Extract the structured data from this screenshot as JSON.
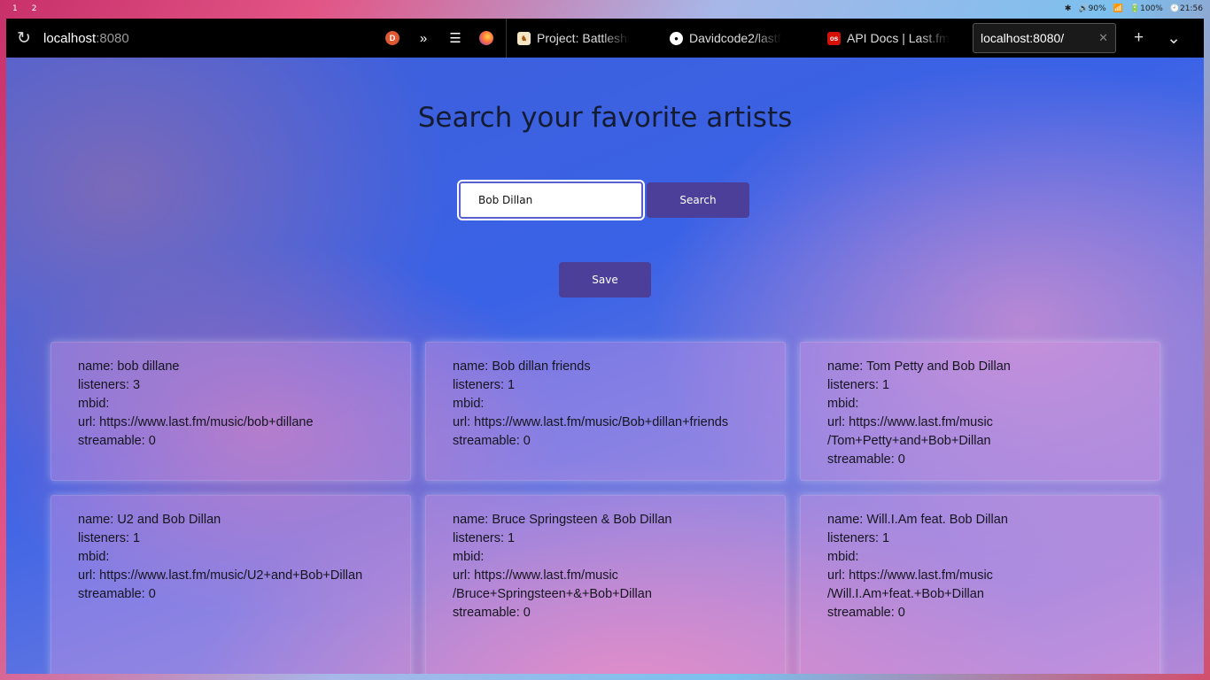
{
  "system_bar": {
    "workspaces": [
      "1",
      "2"
    ],
    "bluetooth": "✱",
    "volume": "🔊90%",
    "wifi": "📶",
    "battery": "🔋100%",
    "clock": "🕘21:56"
  },
  "browser": {
    "url_host": "localhost",
    "url_port": ":8080",
    "tabs": [
      {
        "title": "Project: Battleshi",
        "favicon": "project-icon"
      },
      {
        "title": "Davidcode2/lastf",
        "favicon": "github-icon"
      },
      {
        "title": "API Docs | Last.fm",
        "favicon": "lastfm-icon"
      },
      {
        "title": "localhost:8080/",
        "favicon": null,
        "active": true
      }
    ]
  },
  "page": {
    "title": "Search your favorite artists",
    "search": {
      "value": "Bob Dillan",
      "button_label": "Search"
    },
    "save_label": "Save",
    "results": [
      {
        "name": "name: bob dillane",
        "listeners": "listeners: 3",
        "mbid": "mbid:",
        "url": "url: https://www.last.fm/music/bob+dillane",
        "streamable": "streamable: 0"
      },
      {
        "name": "name: Bob dillan friends",
        "listeners": "listeners: 1",
        "mbid": "mbid:",
        "url": "url: https://www.last.fm/music/Bob+dillan+friends",
        "streamable": "streamable: 0"
      },
      {
        "name": "name: Tom Petty and Bob Dillan",
        "listeners": "listeners: 1",
        "mbid": "mbid:",
        "url": "url: https://www.last.fm/music\n/Tom+Petty+and+Bob+Dillan",
        "streamable": "streamable: 0"
      },
      {
        "name": "name: U2 and Bob Dillan",
        "listeners": "listeners: 1",
        "mbid": "mbid:",
        "url": "url: https://www.last.fm/music/U2+and+Bob+Dillan",
        "streamable": "streamable: 0"
      },
      {
        "name": "name: Bruce Springsteen & Bob Dillan",
        "listeners": "listeners: 1",
        "mbid": "mbid:",
        "url": "url: https://www.last.fm/music\n/Bruce+Springsteen+&+Bob+Dillan",
        "streamable": "streamable: 0"
      },
      {
        "name": "name: Will.I.Am feat. Bob Dillan",
        "listeners": "listeners: 1",
        "mbid": "mbid:",
        "url": "url: https://www.last.fm/music\n/Will.I.Am+feat.+Bob+Dillan",
        "streamable": "streamable: 0"
      }
    ]
  }
}
